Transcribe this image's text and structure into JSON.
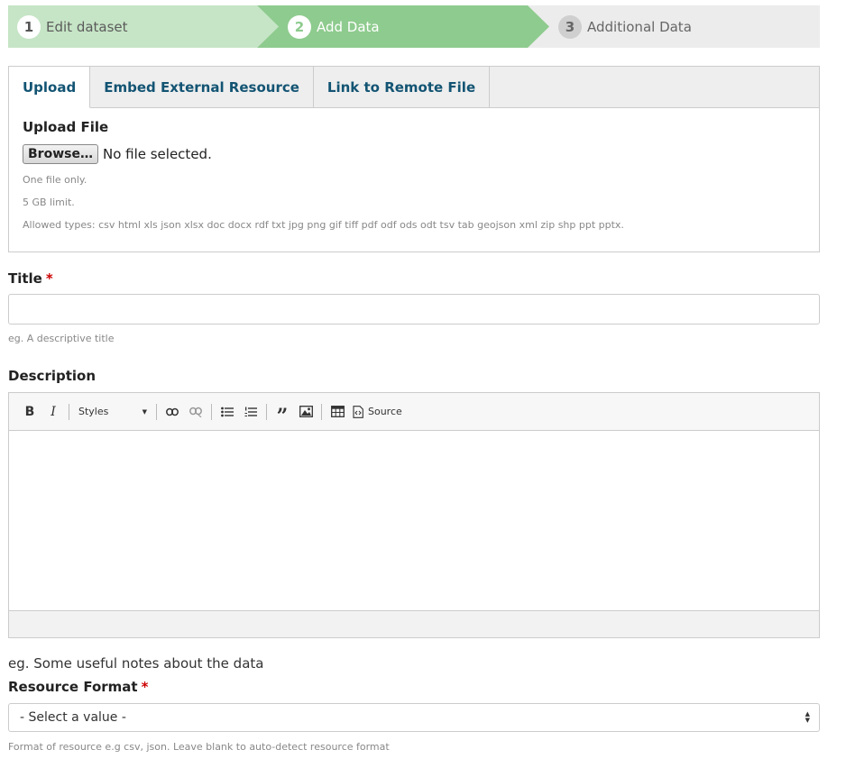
{
  "stepper": {
    "steps": [
      {
        "num": "1",
        "label": "Edit dataset"
      },
      {
        "num": "2",
        "label": "Add Data"
      },
      {
        "num": "3",
        "label": "Additional Data"
      }
    ],
    "colors": {
      "done": "#c6e5c6",
      "active": "#8ecb8e",
      "pending": "#ececec"
    }
  },
  "upload": {
    "tabs": [
      "Upload",
      "Embed External Resource",
      "Link to Remote File"
    ],
    "active_tab": "Upload",
    "label": "Upload File",
    "browse_label": "Browse…",
    "file_status": "No file selected.",
    "hints": [
      "One file only.",
      "5 GB limit.",
      "Allowed types: csv html xls json xlsx doc docx rdf txt jpg png gif tiff pdf odf ods odt tsv tab geojson xml zip shp ppt pptx."
    ]
  },
  "title_field": {
    "label": "Title",
    "required_mark": "*",
    "value": "",
    "hint": "eg. A descriptive title"
  },
  "description_field": {
    "label": "Description",
    "toolbar": {
      "styles_label": "Styles",
      "source_label": "Source",
      "icons": [
        "bold-icon",
        "italic-icon",
        "link-icon",
        "unlink-icon",
        "bulleted-list-icon",
        "numbered-list-icon",
        "blockquote-icon",
        "image-icon",
        "table-icon",
        "source-icon"
      ]
    },
    "hint": "eg. Some useful notes about the data"
  },
  "format_field": {
    "label": "Resource Format",
    "required_mark": "*",
    "selected": "- Select a value -",
    "hint": "Format of resource e.g csv, json. Leave blank to auto-detect resource format"
  }
}
